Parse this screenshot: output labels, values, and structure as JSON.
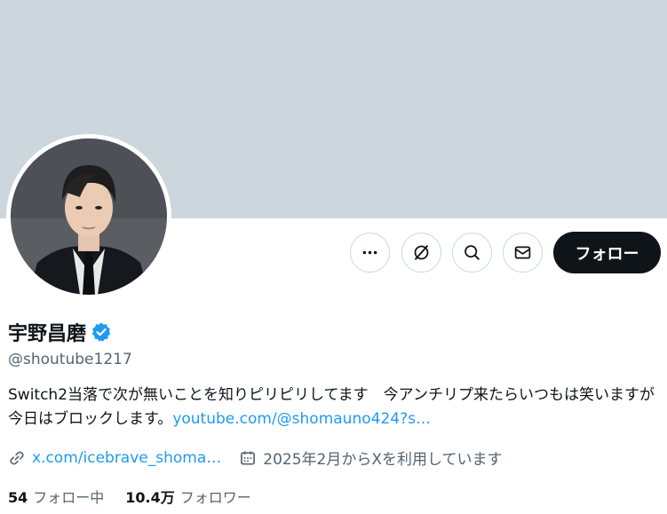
{
  "header": {
    "banner_color": "#ccd6dd"
  },
  "profile": {
    "display_name": "宇野昌磨",
    "handle": "@shoutube1217",
    "verified": true,
    "bio_text": "Switch2当落で次が無いことを知りピリピリしてます　今アンチリプ来たらいつもは笑いますが今日はブロックします。",
    "bio_link": "youtube.com/@shomauno424?s…",
    "website": "x.com/icebrave_shoma…",
    "joined": "2025年2月からXを利用しています"
  },
  "actions": {
    "more_icon": "more-dots-icon",
    "grok_icon": "grok-icon",
    "search_icon": "search-icon",
    "message_icon": "mail-icon",
    "follow_label": "フォロー"
  },
  "stats": {
    "following_count": "54",
    "following_label": "フォロー中",
    "followers_count": "10.4万",
    "followers_label": "フォロワー"
  },
  "colors": {
    "accent": "#1d9bf0",
    "text": "#0f1419",
    "secondary_text": "#536471",
    "button_dark": "#0f1419"
  }
}
